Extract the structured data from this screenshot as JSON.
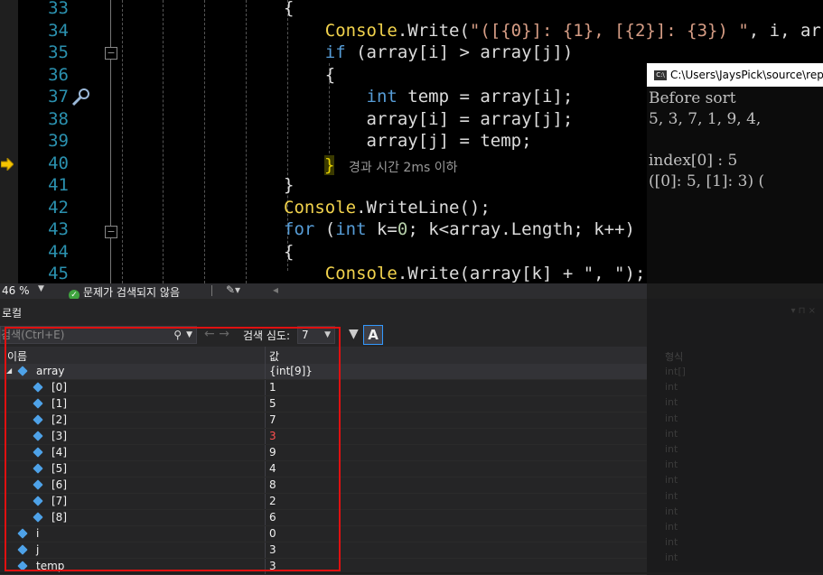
{
  "editor": {
    "line_numbers": [
      "33",
      "34",
      "35",
      "36",
      "37",
      "38",
      "39",
      "40",
      "41",
      "42",
      "43",
      "44",
      "45"
    ],
    "code_lines": [
      {
        "parts": [
          {
            "t": "{",
            "c": "var"
          }
        ]
      },
      {
        "parts": [
          {
            "t": "    ",
            "c": "var"
          },
          {
            "t": "Console",
            "c": "cls"
          },
          {
            "t": ".Write(",
            "c": "var"
          },
          {
            "t": "\"([{0}]: {1}, [{2}]: {3}) \"",
            "c": "str"
          },
          {
            "t": ", i, arr",
            "c": "var"
          }
        ]
      },
      {
        "parts": [
          {
            "t": "    ",
            "c": "var"
          },
          {
            "t": "if",
            "c": "kw"
          },
          {
            "t": " (array[i] > array[j])",
            "c": "var"
          }
        ]
      },
      {
        "parts": [
          {
            "t": "    {",
            "c": "var"
          }
        ]
      },
      {
        "parts": [
          {
            "t": "        ",
            "c": "var"
          },
          {
            "t": "int",
            "c": "kw"
          },
          {
            "t": " temp = array[i];",
            "c": "var"
          }
        ]
      },
      {
        "parts": [
          {
            "t": "        array[i] = array[j];",
            "c": "var"
          }
        ]
      },
      {
        "parts": [
          {
            "t": "        array[j] = temp;",
            "c": "var"
          }
        ]
      },
      {
        "parts": [
          {
            "t": "    ",
            "c": "var"
          }
        ]
      },
      {
        "parts": [
          {
            "t": "}",
            "c": "var"
          }
        ]
      },
      {
        "parts": [
          {
            "t": "Console",
            "c": "cls"
          },
          {
            "t": ".WriteLine();",
            "c": "var"
          }
        ]
      },
      {
        "parts": [
          {
            "t": "for",
            "c": "kw"
          },
          {
            "t": " (",
            "c": "var"
          },
          {
            "t": "int",
            "c": "kw"
          },
          {
            "t": " k=",
            "c": "var"
          },
          {
            "t": "0",
            "c": "num"
          },
          {
            "t": "; k<array.Length; k++)",
            "c": "var"
          }
        ]
      },
      {
        "parts": [
          {
            "t": "{",
            "c": "var"
          }
        ]
      },
      {
        "parts": [
          {
            "t": "    ",
            "c": "var"
          },
          {
            "t": "Console",
            "c": "cls"
          },
          {
            "t": ".Write(array[k] + \", \");",
            "c": "var"
          }
        ]
      }
    ],
    "elapsed_hint": "경과 시간 2ms 이하",
    "closing_brace": "}"
  },
  "console": {
    "title": "C:\\Users\\JaysPick\\source\\rep",
    "lines": [
      "Before sort",
      "5, 3, 7, 1, 9, 4,",
      "",
      "index[0] : 5",
      "([0]: 5, [1]: 3) ("
    ]
  },
  "status": {
    "zoom": "46 %",
    "issues": "문제가 검색되지 않음"
  },
  "locals": {
    "title": "로컬",
    "search_placeholder": "검색(Ctrl+E)",
    "depth_label": "검색 심도:",
    "depth_value": "7",
    "a_button": "A",
    "col_name": "이름",
    "col_value": "값",
    "rows": [
      {
        "name": "array",
        "value": "{int[9]}",
        "level": 0,
        "expander": true,
        "changed": false
      },
      {
        "name": "[0]",
        "value": "1",
        "level": 1,
        "expander": false,
        "changed": false
      },
      {
        "name": "[1]",
        "value": "5",
        "level": 1,
        "expander": false,
        "changed": false
      },
      {
        "name": "[2]",
        "value": "7",
        "level": 1,
        "expander": false,
        "changed": false
      },
      {
        "name": "[3]",
        "value": "3",
        "level": 1,
        "expander": false,
        "changed": true
      },
      {
        "name": "[4]",
        "value": "9",
        "level": 1,
        "expander": false,
        "changed": false
      },
      {
        "name": "[5]",
        "value": "4",
        "level": 1,
        "expander": false,
        "changed": false
      },
      {
        "name": "[6]",
        "value": "8",
        "level": 1,
        "expander": false,
        "changed": false
      },
      {
        "name": "[7]",
        "value": "2",
        "level": 1,
        "expander": false,
        "changed": false
      },
      {
        "name": "[8]",
        "value": "6",
        "level": 1,
        "expander": false,
        "changed": false
      },
      {
        "name": "i",
        "value": "0",
        "level": 0,
        "expander": false,
        "changed": false
      },
      {
        "name": "j",
        "value": "3",
        "level": 0,
        "expander": false,
        "changed": false
      },
      {
        "name": "temp",
        "value": "3",
        "level": 0,
        "expander": false,
        "changed": false
      }
    ]
  },
  "right_panel": {
    "header": "형식",
    "items": [
      "int[]",
      "int",
      "int",
      "int",
      "int",
      "int",
      "int",
      "int",
      "int",
      "int",
      "int",
      "int",
      "int"
    ]
  },
  "colors": {
    "highlight_box": "#e01010",
    "changed_value": "#ff5050"
  }
}
